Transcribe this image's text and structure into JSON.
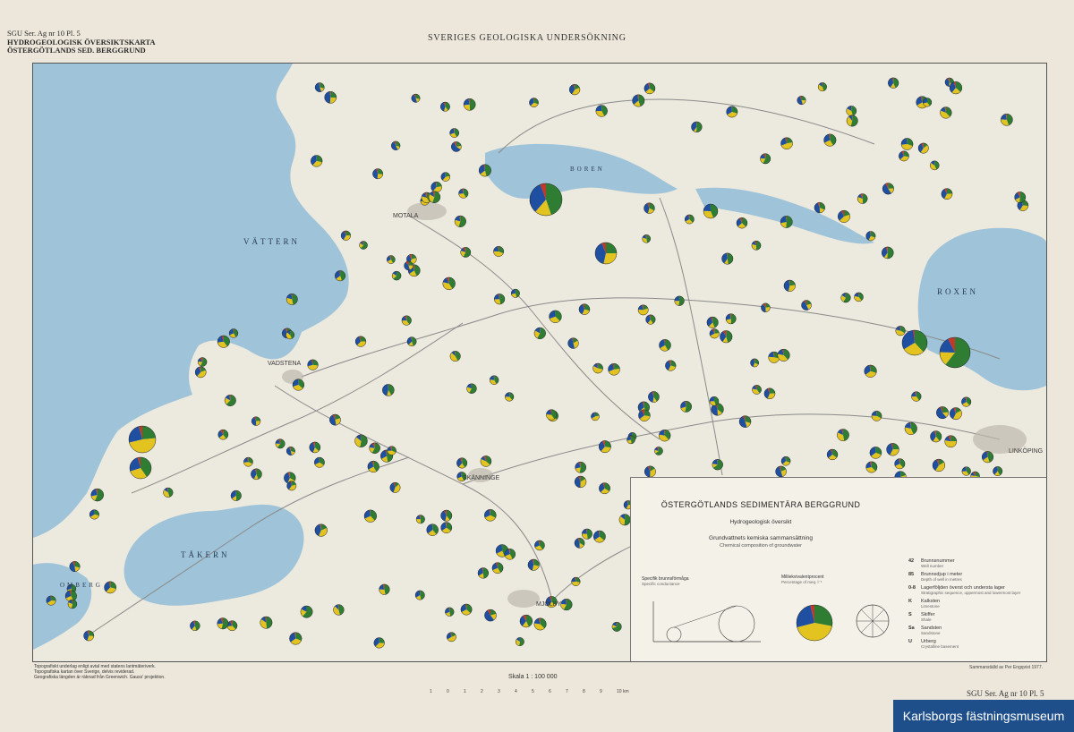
{
  "header": {
    "series": "SGU Ser. Ag nr 10  Pl. 5",
    "map_type": "HYDROGEOLOGISK ÖVERSIKTSKARTA",
    "region": "ÖSTERGÖTLANDS SED. BERGGRUND",
    "survey": "SVERIGES GEOLOGISKA UNDERSÖKNING"
  },
  "map": {
    "lakes": {
      "vattern": "VÄTTERN",
      "boren": "BOREN",
      "roxen": "ROXEN",
      "takern": "TÅKERN",
      "ombergs": "OMBERG"
    },
    "cities": {
      "motala": "MOTALA",
      "vadstena": "VADSTENA",
      "skanninge": "SKÄNNINGE",
      "mjolby": "MJÖLBY",
      "linkoping": "LINKÖPING"
    }
  },
  "legend": {
    "title": "ÖSTERGÖTLANDS SEDIMENTÄRA BERGGRUND",
    "subtitle": "Hydrogeologisk översikt",
    "section": "Grundvattnets kemiska sammansättning",
    "section_en": "Chemical composition of groundwater",
    "specific_capacity": "Specifik brunnsförmåga",
    "specific_capacity_en": "Specific conductance",
    "percent_label": "Milliekvivalentprocent",
    "percent_label_en": "Percentage of meq. l⁻¹",
    "items": [
      {
        "code": "42",
        "label": "Brunnsnummer",
        "en": "Well number"
      },
      {
        "code": "85",
        "label": "Brunnsdjup i meter",
        "en": "Depth of well in metres"
      },
      {
        "code": "0-8",
        "label": "Lagerföljden överst och understa lager",
        "en": "Stratigraphic sequence, uppermost and lowermost layer"
      },
      {
        "code": "K",
        "label": "Kalksten",
        "en": "Limestone"
      },
      {
        "code": "S",
        "label": "Skiffer",
        "en": "Shale"
      },
      {
        "code": "Sa",
        "label": "Sandsten",
        "en": "Sandstone"
      },
      {
        "code": "U",
        "label": "Urberg",
        "en": "Crystalline basement"
      }
    ],
    "credit": "Sammanställd av Per Engqvist 1977."
  },
  "footnote": {
    "line1": "Topografiskt underlag enligt avtal med statens lantmäteriverk.",
    "line2": "Topografiska kartan över Sverige, delvis reviderad.",
    "line3": "Geografiska längden är räknad från Greenwich. Gauss' projektion."
  },
  "scale": {
    "label": "Skala 1 : 100 000",
    "ticks": [
      "1",
      "0",
      "1",
      "2",
      "3",
      "4",
      "5",
      "6",
      "7",
      "8",
      "9",
      "10 km"
    ]
  },
  "footer": {
    "series": "SGU Ser. Ag nr 10  Pl. 5"
  },
  "watermark": "Karlsborgs fästningsmuseum",
  "colors": {
    "paper": "#ece7da",
    "land": "#ece9df",
    "water": "#9fc3d8",
    "pie_green": "#2f7d32",
    "pie_yellow": "#e3c320",
    "pie_blue": "#1f4fa0",
    "pie_red": "#c0392b",
    "road": "#8a8a8a",
    "museum_badge": "#1e4f8b"
  }
}
